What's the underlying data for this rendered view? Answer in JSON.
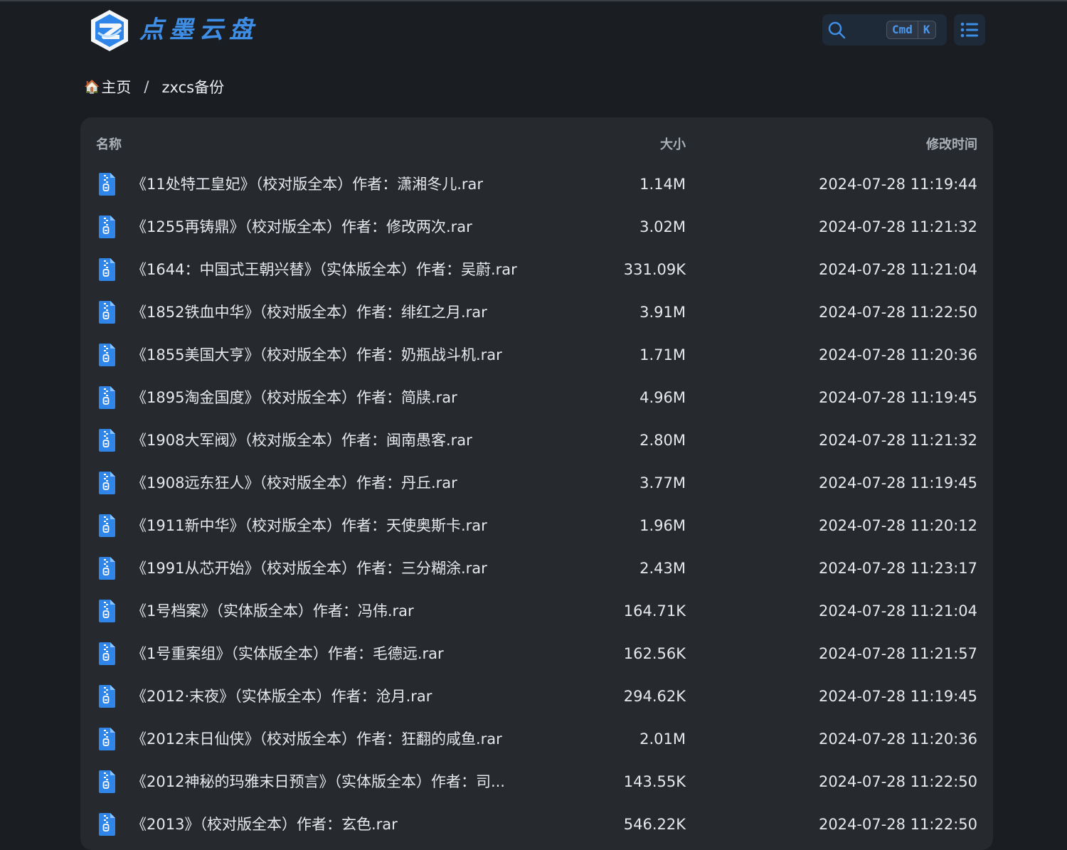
{
  "brand": {
    "name": "点墨云盘"
  },
  "search": {
    "shortcut_mod": "Cmd",
    "shortcut_key": "K"
  },
  "breadcrumb": {
    "home": "主页",
    "separator": "/",
    "current": "zxcs备份"
  },
  "table": {
    "headers": {
      "name": "名称",
      "size": "大小",
      "modified": "修改时间"
    },
    "rows": [
      {
        "name": "《11处特工皇妃》（校对版全本）作者：潇湘冬儿.rar",
        "size": "1.14M",
        "modified": "2024-07-28 11:19:44"
      },
      {
        "name": "《1255再铸鼎》（校对版全本）作者：修改两次.rar",
        "size": "3.02M",
        "modified": "2024-07-28 11:21:32"
      },
      {
        "name": "《1644：中国式王朝兴替》（实体版全本）作者：吴蔚.rar",
        "size": "331.09K",
        "modified": "2024-07-28 11:21:04"
      },
      {
        "name": "《1852铁血中华》（校对版全本）作者：绯红之月.rar",
        "size": "3.91M",
        "modified": "2024-07-28 11:22:50"
      },
      {
        "name": "《1855美国大亨》（校对版全本）作者：奶瓶战斗机.rar",
        "size": "1.71M",
        "modified": "2024-07-28 11:20:36"
      },
      {
        "name": "《1895淘金国度》（校对版全本）作者：简牍.rar",
        "size": "4.96M",
        "modified": "2024-07-28 11:19:45"
      },
      {
        "name": "《1908大军阀》（校对版全本）作者：闽南愚客.rar",
        "size": "2.80M",
        "modified": "2024-07-28 11:21:32"
      },
      {
        "name": "《1908远东狂人》（校对版全本）作者：丹丘.rar",
        "size": "3.77M",
        "modified": "2024-07-28 11:19:45"
      },
      {
        "name": "《1911新中华》（校对版全本）作者：天使奥斯卡.rar",
        "size": "1.96M",
        "modified": "2024-07-28 11:20:12"
      },
      {
        "name": "《1991从芯开始》（校对版全本）作者：三分糊涂.rar",
        "size": "2.43M",
        "modified": "2024-07-28 11:23:17"
      },
      {
        "name": "《1号档案》（实体版全本）作者：冯伟.rar",
        "size": "164.71K",
        "modified": "2024-07-28 11:21:04"
      },
      {
        "name": "《1号重案组》（实体版全本）作者：毛德远.rar",
        "size": "162.56K",
        "modified": "2024-07-28 11:21:57"
      },
      {
        "name": "《2012·末夜》（实体版全本）作者：沧月.rar",
        "size": "294.62K",
        "modified": "2024-07-28 11:19:45"
      },
      {
        "name": "《2012末日仙侠》（校对版全本）作者：狂翻的咸鱼.rar",
        "size": "2.01M",
        "modified": "2024-07-28 11:20:36"
      },
      {
        "name": "《2012神秘的玛雅末日预言》（实体版全本）作者：司...",
        "size": "143.55K",
        "modified": "2024-07-28 11:22:50"
      },
      {
        "name": "《2013》（校对版全本）作者：玄色.rar",
        "size": "546.22K",
        "modified": "2024-07-28 11:22:50"
      }
    ]
  },
  "colors": {
    "accent": "#3f8ee6",
    "file_icon": "#2f86e8",
    "panel": "#262a2f",
    "page": "#1a1d21"
  }
}
